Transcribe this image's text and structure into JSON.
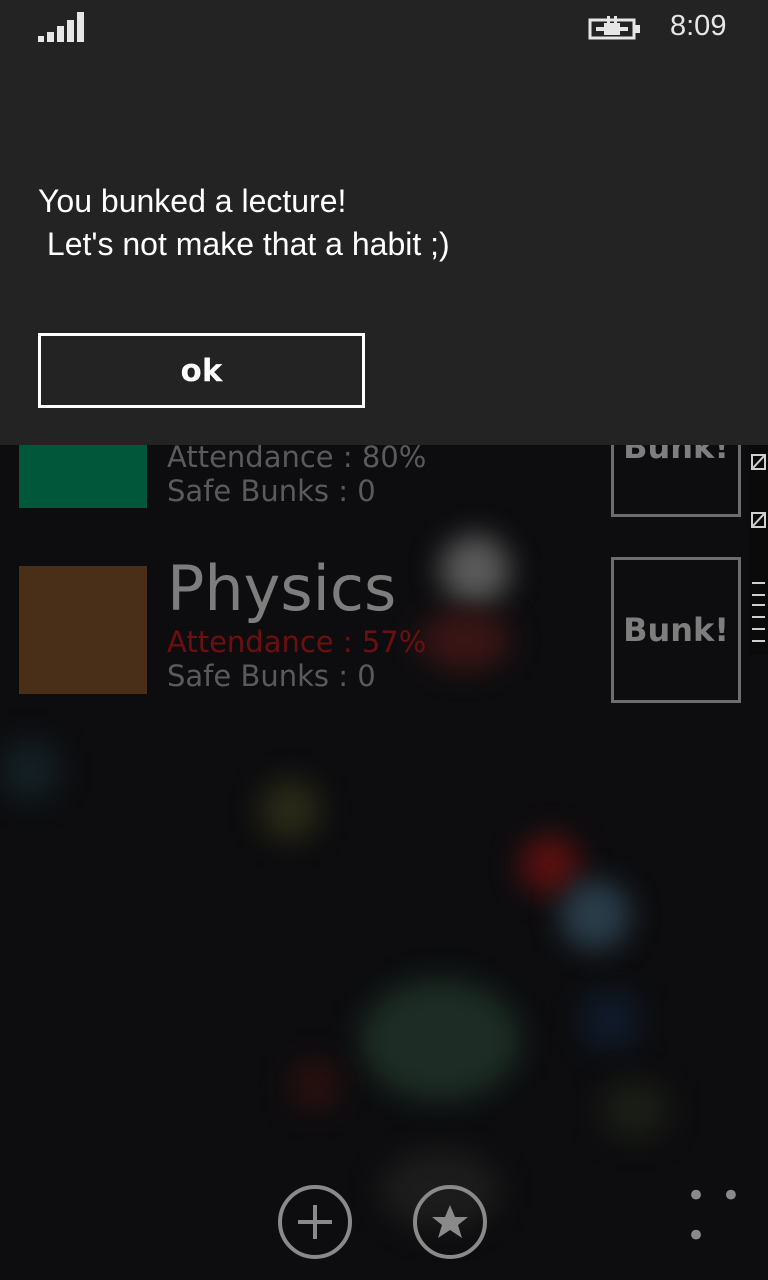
{
  "status_bar": {
    "time": "8:09"
  },
  "dialog": {
    "message_line1": "You bunked a lecture!",
    "message_line2": " Let's not make that a habit ;)",
    "ok_label": "ok"
  },
  "subjects": [
    {
      "name": "",
      "attendance": "Attendance : 80%",
      "safe_bunks": "Safe Bunks : 0",
      "tile_color": "#00573a",
      "bunk_label": "Bunk!"
    },
    {
      "name": "Physics",
      "attendance": "Attendance : 57%",
      "safe_bunks": "Safe Bunks : 0",
      "tile_color": "#4a2f18",
      "bunk_label": "Bunk!"
    }
  ],
  "app_bar": {
    "buttons": [
      "add-icon",
      "favorite-icon"
    ],
    "more_label": "• • •"
  }
}
